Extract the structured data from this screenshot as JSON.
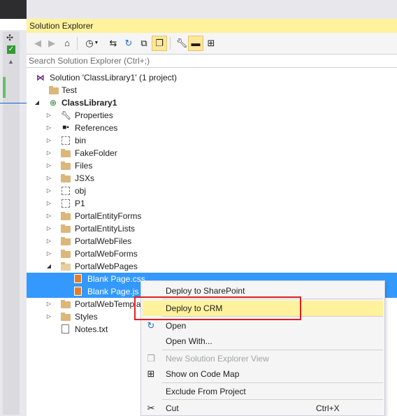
{
  "panel_title": "Solution Explorer",
  "search": {
    "placeholder": "Search Solution Explorer (Ctrl+;)"
  },
  "toolbar": {
    "buttons": [
      "back-icon",
      "forward-icon",
      "home-icon",
      "pending-changes-icon",
      "sync-icon",
      "refresh-icon",
      "collapse-all-icon",
      "show-all-files-icon",
      "properties-icon",
      "preview-icon",
      "code-map-icon"
    ]
  },
  "tree": {
    "items": [
      {
        "label": "Solution 'ClassLibrary1' (1 project)",
        "icon": "solution-icon"
      },
      {
        "label": "Test",
        "icon": "folder-icon"
      },
      {
        "label": "ClassLibrary1",
        "icon": "project-icon",
        "bold": true
      },
      {
        "label": "Properties",
        "icon": "wrench-icon"
      },
      {
        "label": "References",
        "icon": "references-icon"
      },
      {
        "label": "bin",
        "icon": "excluded-folder-icon"
      },
      {
        "label": "FakeFolder",
        "icon": "folder-icon"
      },
      {
        "label": "Files",
        "icon": "folder-icon"
      },
      {
        "label": "JSXs",
        "icon": "folder-icon"
      },
      {
        "label": "obj",
        "icon": "excluded-folder-icon"
      },
      {
        "label": "P1",
        "icon": "excluded-folder-icon"
      },
      {
        "label": "PortalEntityForms",
        "icon": "folder-icon"
      },
      {
        "label": "PortalEntityLists",
        "icon": "folder-icon"
      },
      {
        "label": "PortalWebFiles",
        "icon": "folder-icon"
      },
      {
        "label": "PortalWebForms",
        "icon": "folder-icon"
      },
      {
        "label": "PortalWebPages",
        "icon": "folder-open-icon"
      },
      {
        "label": "Blank Page.css",
        "icon": "css-file-icon",
        "selected": true
      },
      {
        "label": "Blank Page.js",
        "icon": "js-file-icon",
        "selected": true
      },
      {
        "label": "PortalWebTempla",
        "icon": "folder-icon"
      },
      {
        "label": "Styles",
        "icon": "folder-icon"
      },
      {
        "label": "Notes.txt",
        "icon": "text-file-icon"
      }
    ]
  },
  "context_menu": {
    "items": [
      {
        "label": "Deploy to SharePoint",
        "icon": ""
      },
      {
        "label": "Deploy to CRM",
        "icon": "",
        "highlighted": true
      },
      {
        "label": "Open",
        "icon": "open-icon"
      },
      {
        "label": "Open With...",
        "icon": ""
      },
      {
        "label": "New Solution Explorer View",
        "icon": "new-view-icon",
        "disabled": true
      },
      {
        "label": "Show on Code Map",
        "icon": "code-map-icon"
      },
      {
        "label": "Exclude From Project",
        "icon": ""
      },
      {
        "label": "Cut",
        "icon": "scissors-icon",
        "shortcut": "Ctrl+X"
      }
    ]
  },
  "colors": {
    "title_bg": "#fff29d",
    "selection": "#3399ff",
    "highlight_box": "#e02020"
  }
}
